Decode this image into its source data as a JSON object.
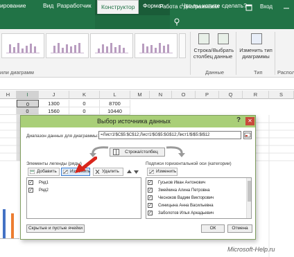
{
  "window": {
    "title": "Работа с диаграммами",
    "signin": "Вход"
  },
  "tabs": [
    {
      "label": "ирование"
    },
    {
      "label": "Вид"
    },
    {
      "label": "Разработчик"
    },
    {
      "label": "Конструктор",
      "active": true
    },
    {
      "label": "Формат"
    },
    {
      "label": "Что вы хотите сделать?"
    }
  ],
  "ribbon": {
    "styles_group_label": "или диаграмм",
    "row_col_button": "Строка/ столбец",
    "select_data_button": "Выбрать данные",
    "data_group_label": "Данные",
    "change_type_button": "Изменить тип диаграммы",
    "type_group_label": "Тип",
    "location_group_label": "Распол"
  },
  "sheet": {
    "columns": [
      "H",
      "I",
      "J",
      "K",
      "L",
      "M",
      "N",
      "O",
      "P",
      "Q",
      "R",
      "S"
    ],
    "selected_column": "I",
    "rows": [
      [
        "",
        "0",
        "1300",
        "0",
        "8700"
      ],
      [
        "",
        "0",
        "1560",
        "0",
        "10440"
      ]
    ]
  },
  "dialog": {
    "title": "Выбор источника данных",
    "help": "?",
    "close": "✕",
    "range_label": "Диапазон данных для диаграммы:",
    "range_value": "=Лист1!$C$5:$C$12;Лист1!$G$5:$G$12;Лист1!$I$5:$I$12",
    "switch_button": "Строка/столбец",
    "legend_pane": {
      "label": "Элементы легенды (ряды)",
      "add": "Добавить",
      "edit": "Изменить",
      "delete": "Удалить",
      "items": [
        {
          "label": "Ряд1",
          "checked": true
        },
        {
          "label": "Ряд2",
          "checked": true
        }
      ]
    },
    "axis_pane": {
      "label": "Подписи горизонтальной оси (категории)",
      "edit": "Изменить",
      "items": [
        {
          "label": "Гуськов Иван Антонович",
          "checked": true
        },
        {
          "label": "Змейкина Алина Петровна",
          "checked": true
        },
        {
          "label": "Чесноков Вадим Викторович",
          "checked": true
        },
        {
          "label": "Синицына Анна Васильевна",
          "checked": true
        },
        {
          "label": "Заболотов Илья Аркадьевич",
          "checked": true
        }
      ]
    },
    "hidden_cells_button": "Скрытые и пустые ячейки",
    "ok": "ОК",
    "cancel": "Отмена"
  },
  "watermark": "Microsoft-Help.ru",
  "colors": {
    "excel_green": "#217346",
    "dialog_title": "#a9cf78",
    "close_red": "#c94a3b",
    "arrow_red": "#d9261c"
  }
}
